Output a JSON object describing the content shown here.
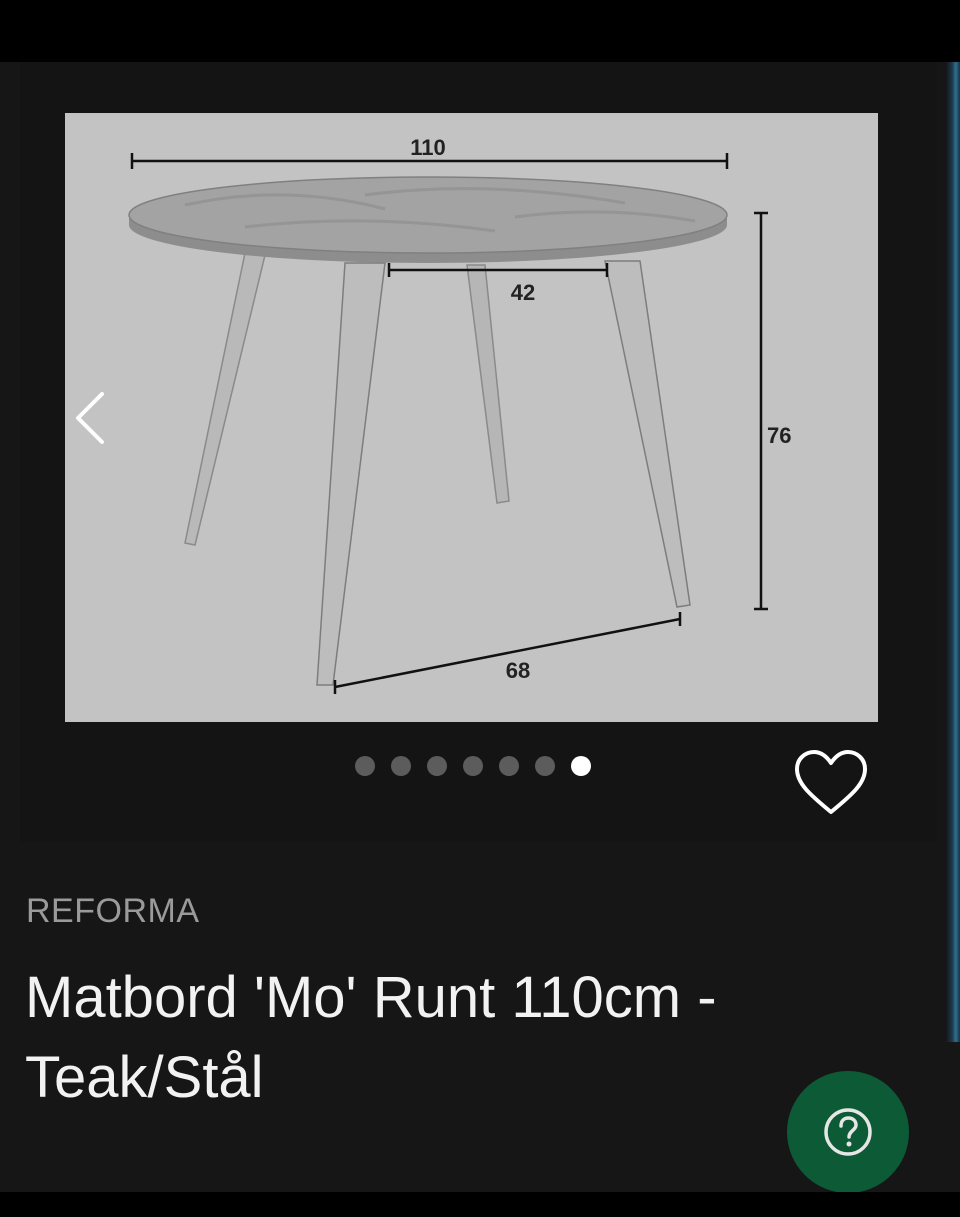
{
  "gallery": {
    "dimensions": {
      "width": "110",
      "leg_spacing_top": "42",
      "height": "76",
      "leg_spacing_bottom": "68"
    },
    "dot_count": 7,
    "active_dot_index": 6,
    "icons": {
      "prev": "chevron-left-icon",
      "favorite": "heart-outline-icon"
    }
  },
  "product": {
    "brand": "REFORMA",
    "title": "Matbord 'Mo' Runt 110cm - Teak/Stål"
  },
  "help_button": {
    "icon": "question-mark-icon",
    "color": "#0d5a36"
  }
}
